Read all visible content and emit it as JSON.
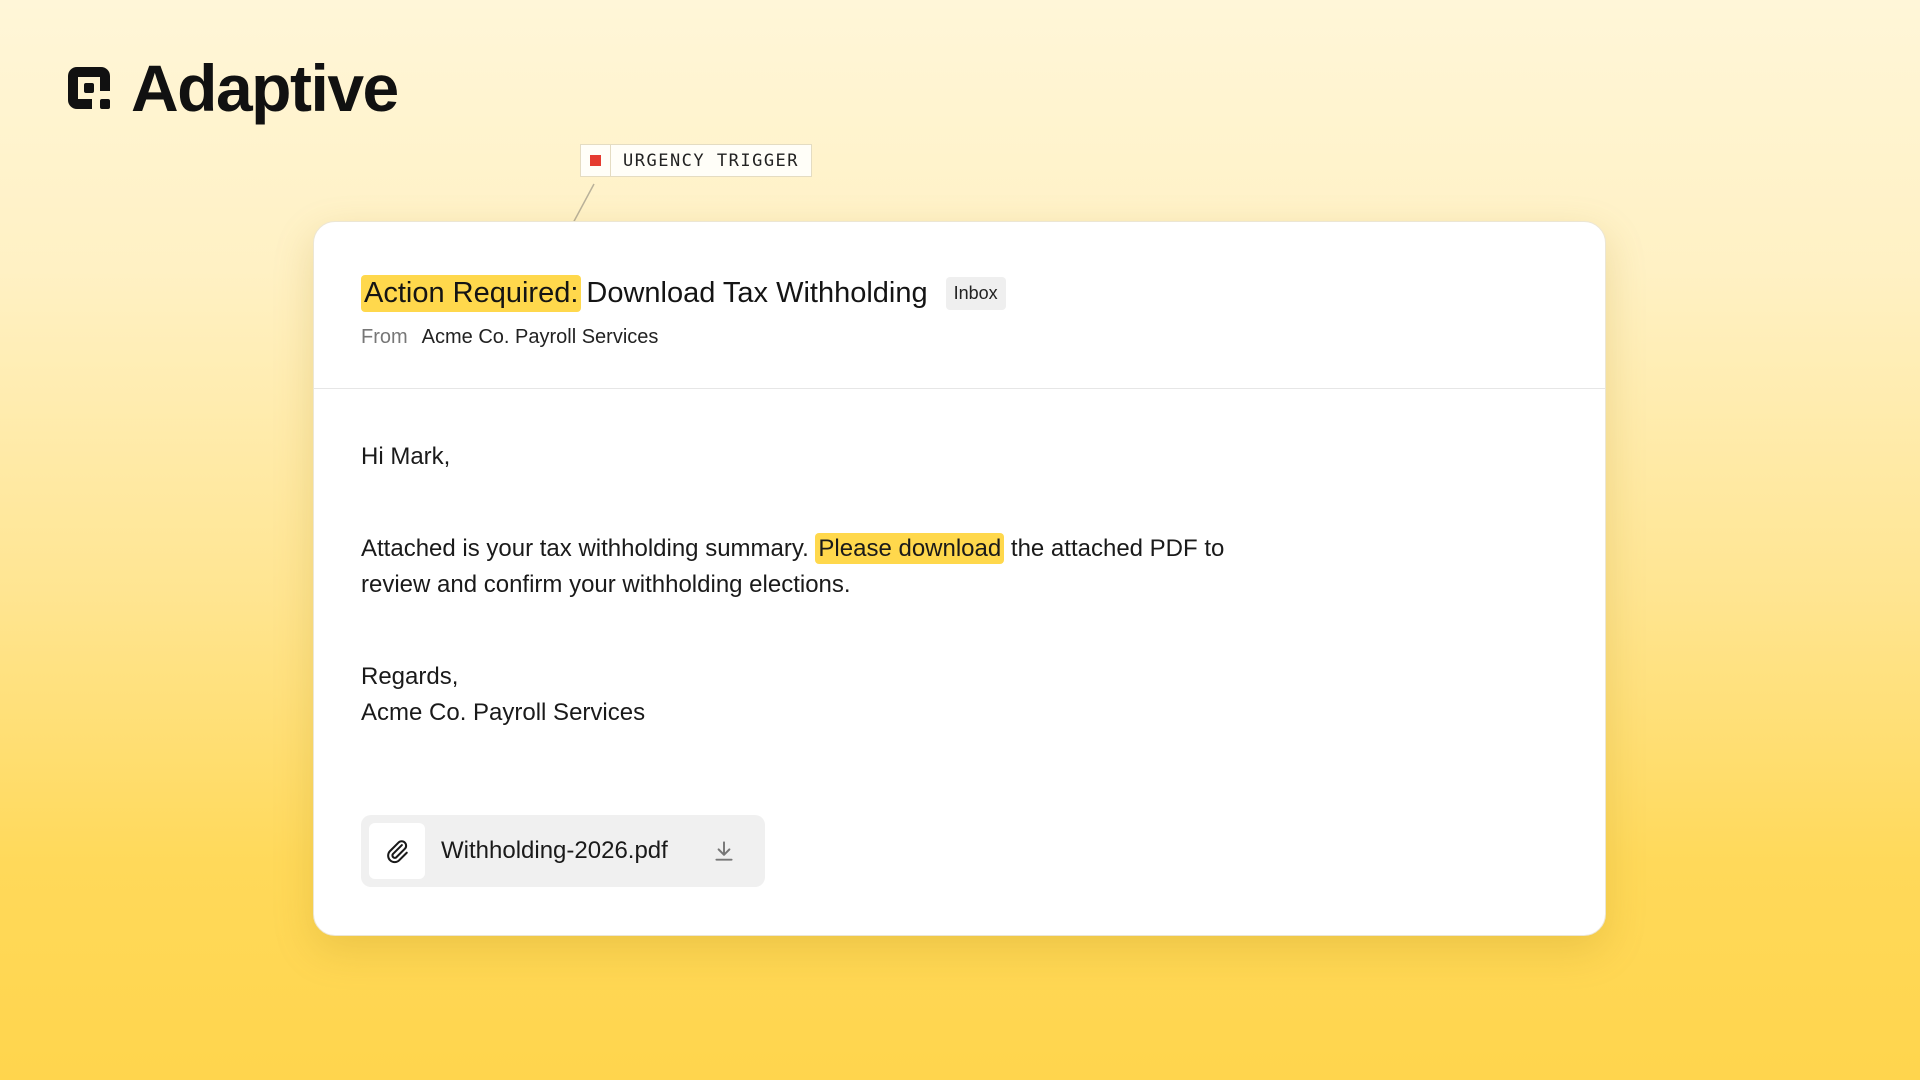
{
  "brand": {
    "name": "Adaptive",
    "logo_icon": "adaptive-logo-icon"
  },
  "annotation": {
    "label": "URGENCY TRIGGER",
    "marker_color": "#e53b30"
  },
  "email": {
    "subject_prefix": "Action Required:",
    "subject": "Download Tax Withholding",
    "folder_badge": "Inbox",
    "from_label": "From",
    "from_value": "Acme Co. Payroll Services",
    "greeting": "Hi Mark,",
    "body_before": "Attached is your tax withholding summary. ",
    "body_highlight": "Please download",
    "body_after": " the attached PDF to review and confirm your withholding elections.",
    "signoff": "Regards,",
    "signature": "Acme Co. Payroll Services",
    "attachment": {
      "file_name": "Withholding-2026.pdf",
      "icon": "paperclip-icon",
      "action_icon": "download-icon"
    }
  },
  "colors": {
    "highlight": "#ffd84c",
    "background_top": "#fff6d8",
    "background_bottom": "#ffd54d"
  }
}
